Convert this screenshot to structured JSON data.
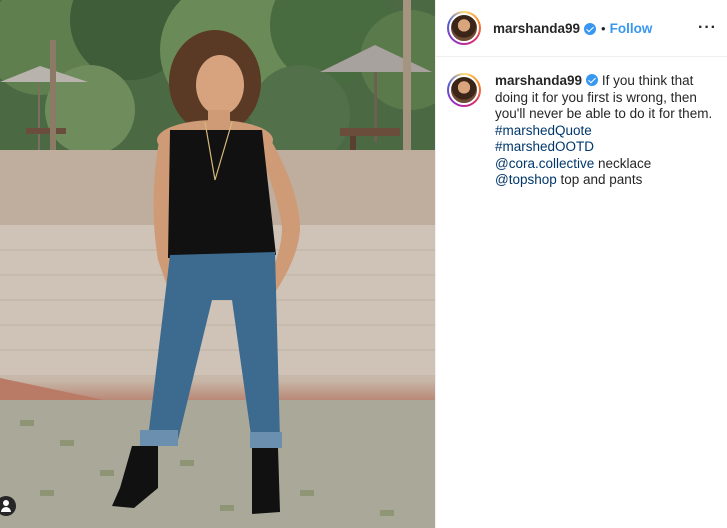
{
  "post": {
    "username": "marshanda99",
    "separator": "•",
    "follow_label": "Follow",
    "more_label": "···"
  },
  "caption": {
    "username": "marshanda99",
    "text": "If you think that doing it for you first is wrong, then you'll never be able to do it for them.",
    "hashtag_1": "#marshedQuote",
    "hashtag_2": "#marshedOOTD",
    "mention_1": "@cora.collective",
    "mention_1_suffix": " necklace",
    "mention_2": "@topshop",
    "mention_2_suffix": " top and pants"
  },
  "icons": {
    "verified": "verified-badge-icon",
    "tagged_user": "user-tag-icon",
    "more": "more-options-icon"
  },
  "colors": {
    "link_blue": "#3897f0",
    "tag_link": "#00376b",
    "verified": "#3897f0"
  }
}
